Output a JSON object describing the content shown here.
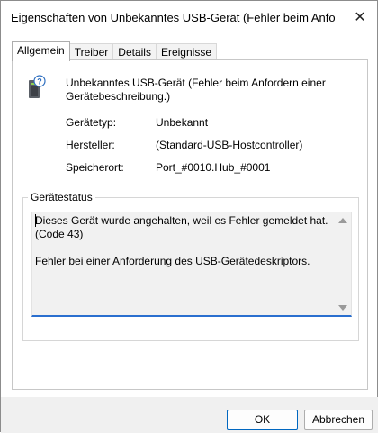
{
  "window": {
    "title": "Eigenschaften von Unbekanntes USB-Gerät (Fehler beim Anforder...",
    "close_glyph": "✕"
  },
  "tabs": [
    {
      "label": "Allgemein",
      "active": true
    },
    {
      "label": "Treiber",
      "active": false
    },
    {
      "label": "Details",
      "active": false
    },
    {
      "label": "Ereignisse",
      "active": false
    }
  ],
  "device": {
    "icon": "usb-device-unknown-icon",
    "name": "Unbekanntes USB-Gerät (Fehler beim Anfordern einer Gerätebeschreibung.)"
  },
  "properties": {
    "type_label": "Gerätetyp:",
    "type_value": "Unbekannt",
    "manufacturer_label": "Hersteller:",
    "manufacturer_value": "(Standard-USB-Hostcontroller)",
    "location_label": "Speicherort:",
    "location_value": "Port_#0010.Hub_#0001"
  },
  "status": {
    "group_title": "Gerätestatus",
    "line1": "Dieses Gerät wurde angehalten, weil es Fehler gemeldet hat.",
    "line2": "(Code 43)",
    "line3": "Fehler bei einer Anforderung des USB-Gerätedeskriptors."
  },
  "buttons": {
    "ok": "OK",
    "cancel": "Abbrechen"
  },
  "colors": {
    "accent": "#0067c0",
    "focus_underline": "#2a6fcf"
  }
}
